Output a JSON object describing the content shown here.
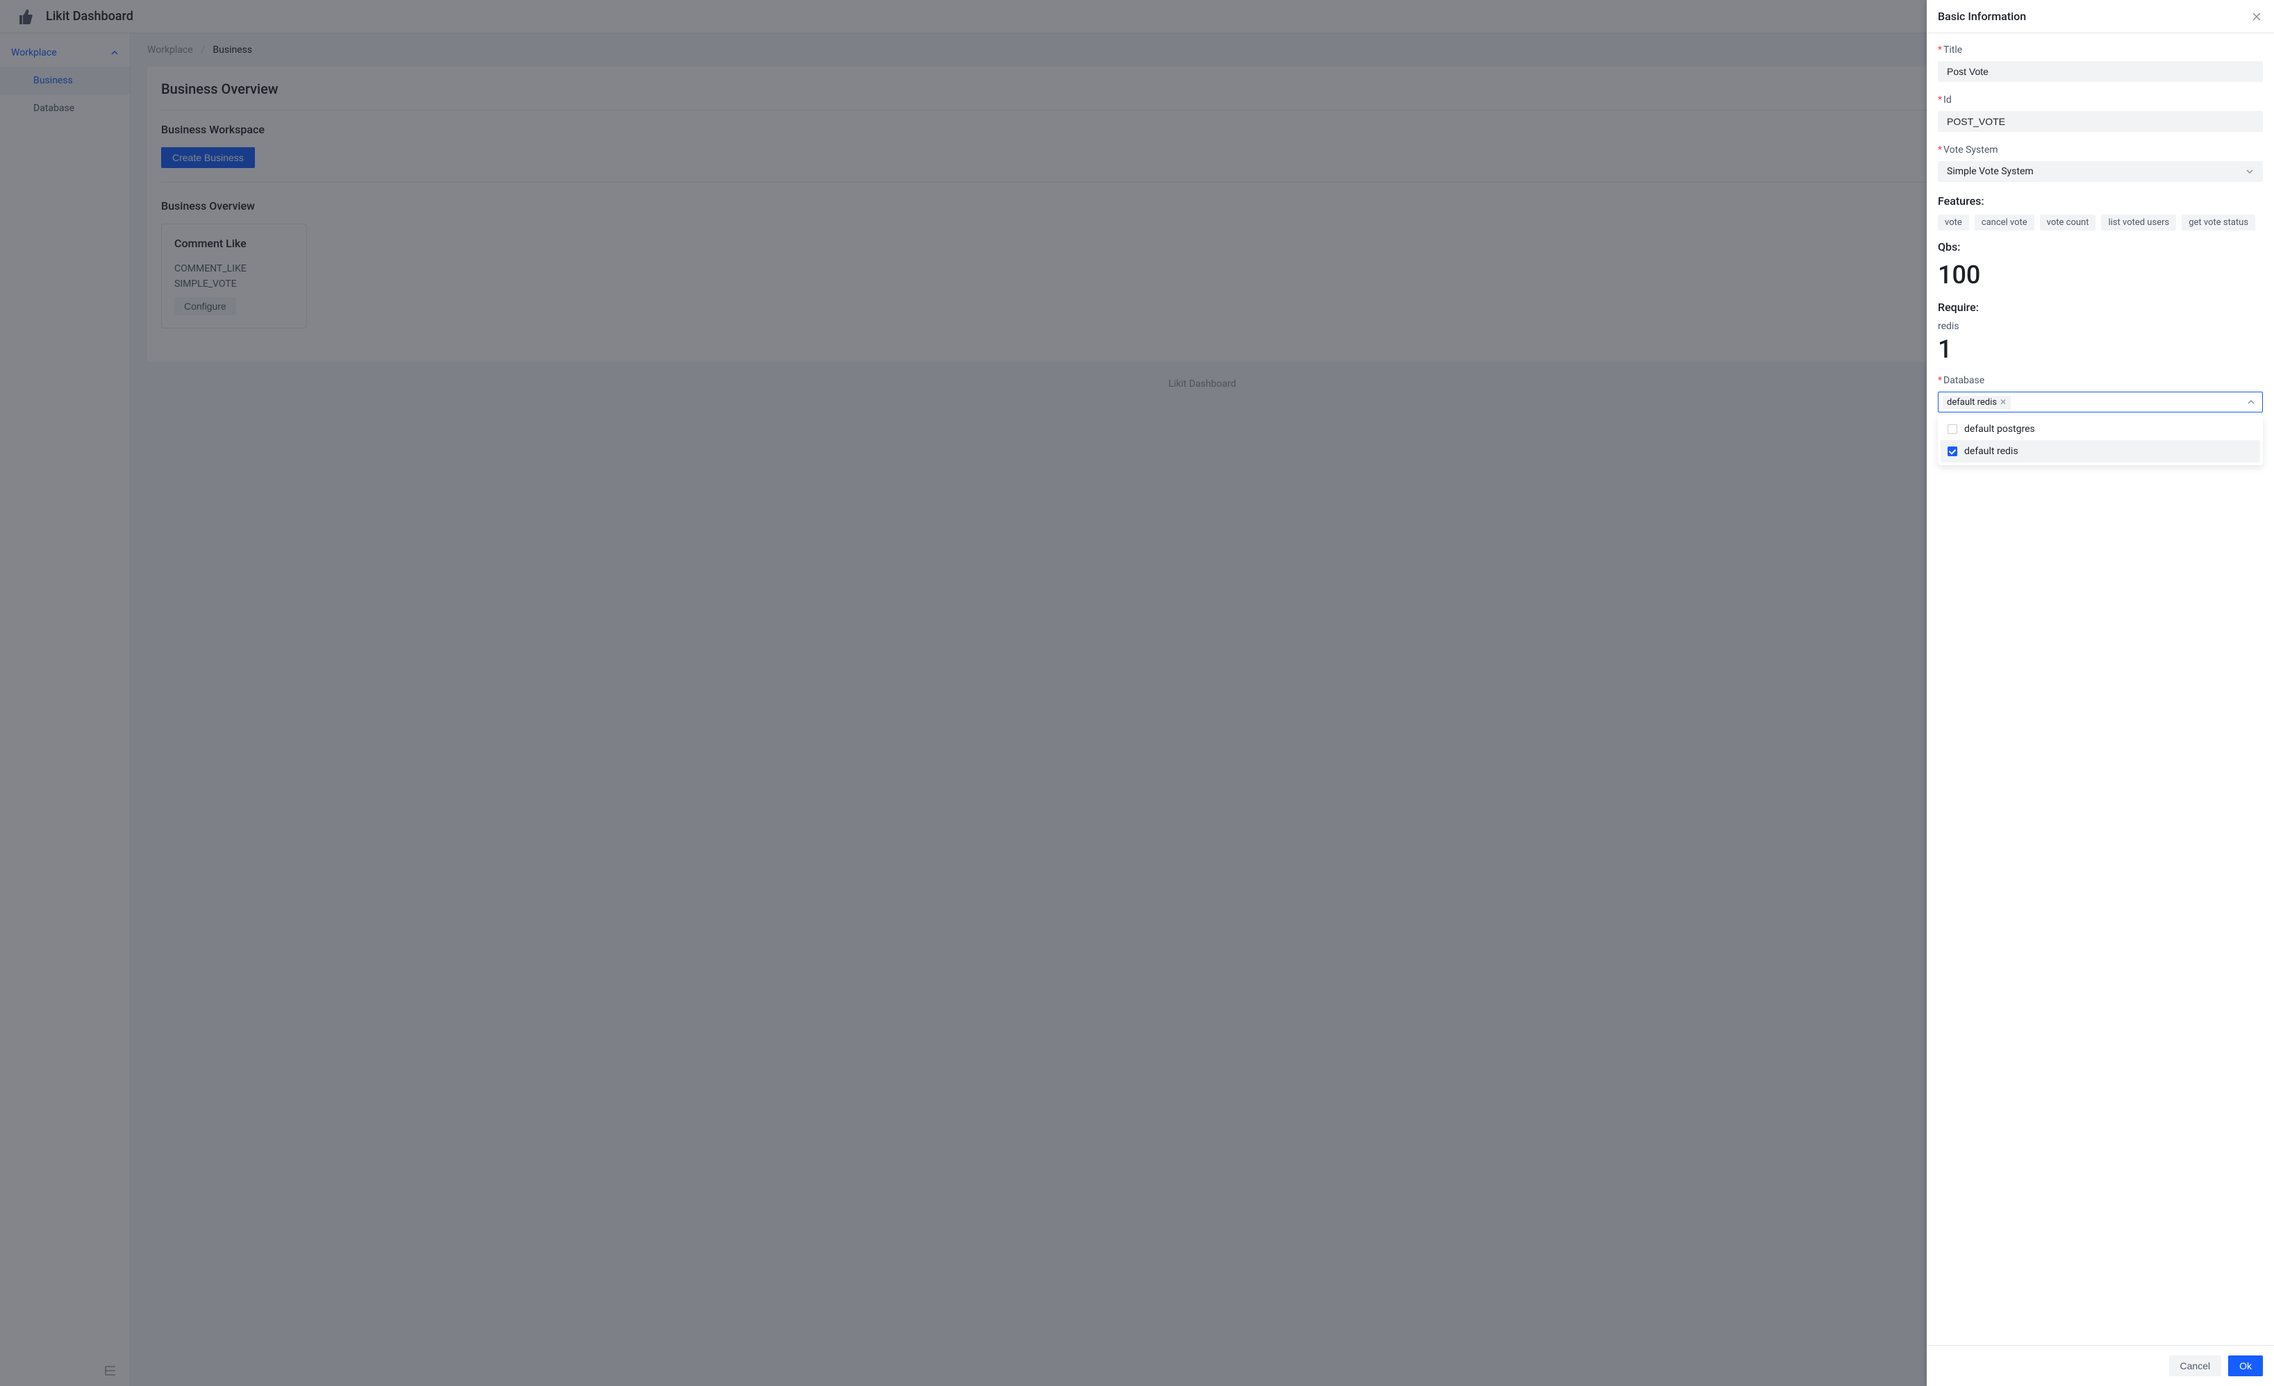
{
  "app_title": "Likit Dashboard",
  "sidebar": {
    "group_label": "Workplace",
    "items": [
      {
        "label": "Business",
        "active": true
      },
      {
        "label": "Database",
        "active": false
      }
    ]
  },
  "breadcrumb": {
    "root": "Workplace",
    "current": "Business"
  },
  "page": {
    "title": "Business Overview",
    "workspace_title": "Business Workspace",
    "create_button": "Create Business",
    "overview_title": "Business Overview"
  },
  "business_card": {
    "title": "Comment Like",
    "line1": "COMMENT_LIKE",
    "line2": "SIMPLE_VOTE",
    "configure": "Configure"
  },
  "footer": "Likit Dashboard",
  "drawer": {
    "title": "Basic Information",
    "fields": {
      "title_label": "Title",
      "title_value": "Post Vote",
      "id_label": "Id",
      "id_value": "POST_VOTE",
      "vote_system_label": "Vote System",
      "vote_system_value": "Simple Vote System",
      "features_label": "Features:",
      "features": [
        "vote",
        "cancel vote",
        "vote count",
        "list voted users",
        "get vote status"
      ],
      "qbs_label": "Qbs:",
      "qbs_value": "100",
      "require_label": "Require:",
      "require_name": "redis",
      "require_value": "1",
      "database_label": "Database",
      "database_selected": "default redis",
      "database_options": [
        {
          "label": "default postgres",
          "checked": false
        },
        {
          "label": "default redis",
          "checked": true
        }
      ]
    },
    "cancel": "Cancel",
    "ok": "Ok"
  }
}
